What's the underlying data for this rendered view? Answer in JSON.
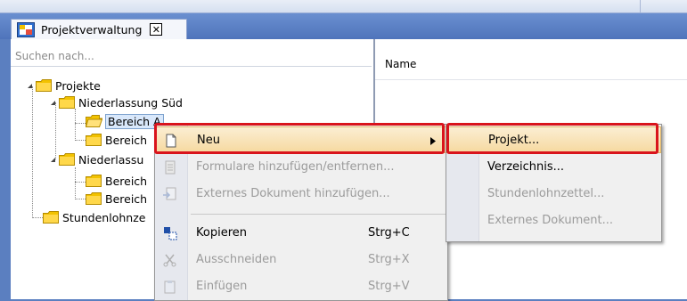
{
  "tab": {
    "label": "Projektverwaltung",
    "close": "✕"
  },
  "search": {
    "placeholder": "Suchen nach..."
  },
  "list": {
    "column_name": "Name"
  },
  "tree": {
    "projekte": "Projekte",
    "niederlassung_sued": "Niederlassung Süd",
    "bereich_a": "Bereich A",
    "bereich_b": "Bereich",
    "niederlassung_2": "Niederlassu",
    "bereich_c": "Bereich",
    "bereich_d": "Bereich",
    "stundenlohnzettel": "Stundenlohnze"
  },
  "context_menu": {
    "items": [
      {
        "label": "Neu",
        "enabled": true,
        "submenu": true,
        "icon": "new-document-icon"
      },
      {
        "label": "Formulare hinzufügen/entfernen...",
        "enabled": false,
        "icon": "form-icon"
      },
      {
        "label": "Externes Dokument hinzufügen...",
        "enabled": false,
        "icon": "external-document-icon"
      },
      {
        "label": "Kopieren",
        "shortcut": "Strg+C",
        "enabled": true,
        "icon": "copy-icon"
      },
      {
        "label": "Ausschneiden",
        "shortcut": "Strg+X",
        "enabled": false,
        "icon": "scissors-icon"
      },
      {
        "label": "Einfügen",
        "shortcut": "Strg+V",
        "enabled": false,
        "icon": "paste-icon"
      }
    ]
  },
  "submenu": {
    "items": [
      {
        "label": "Projekt...",
        "enabled": true
      },
      {
        "label": "Verzeichnis...",
        "enabled": true
      },
      {
        "label": "Stundenlohnzettel...",
        "enabled": false
      },
      {
        "label": "Externes Dokument...",
        "enabled": false
      }
    ]
  },
  "colors": {
    "highlight_border": "#d9141c",
    "hover_bg": "#f6d9a0",
    "folder": "#f2c200"
  }
}
